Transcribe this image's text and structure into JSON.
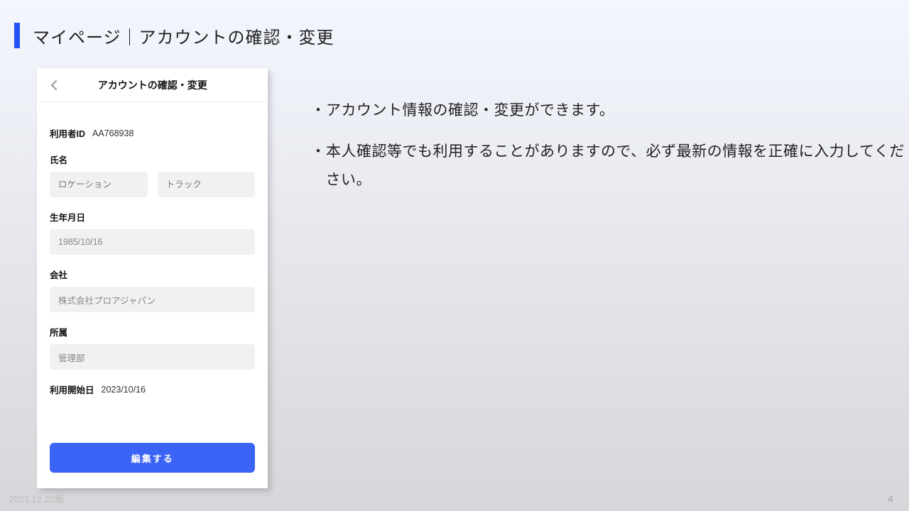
{
  "header": {
    "title": "マイページ｜アカウントの確認・変更"
  },
  "phone": {
    "header_title": "アカウントの確認・変更",
    "user_id_label": "利用者ID",
    "user_id_value": "AA768938",
    "name_label": "氏名",
    "name_last_placeholder": "ロケーション",
    "name_first_placeholder": "トラック",
    "dob_label": "生年月日",
    "dob_value": "1985/10/16",
    "company_label": "会社",
    "company_value": "株式会社プロアジャパン",
    "dept_label": "所属",
    "dept_value": "管理部",
    "start_label": "利用開始日",
    "start_value": "2023/10/16",
    "edit_button": "編集する"
  },
  "desc": {
    "line1": "・アカウント情報の確認・変更ができます。",
    "line2": "・本人確認等でも利用することがありますので、必ず最新の情報を正確に入力してください。"
  },
  "footer": {
    "version": "2023.12.20版",
    "page": "4"
  }
}
